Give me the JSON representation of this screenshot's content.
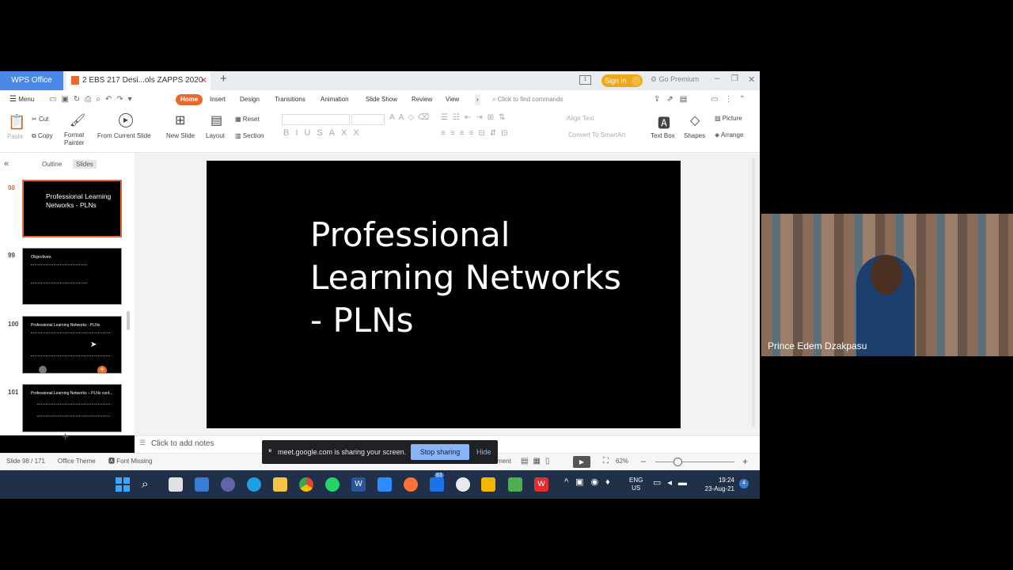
{
  "titlebar": {
    "app_tab": "WPS Office",
    "doc_tab": "2 EBS 217 Desi...ols ZAPPS 2020",
    "sign_in": "Sign in",
    "go_premium": "Go Premium"
  },
  "menu": {
    "menu_label": "Menu",
    "tabs": [
      "Home",
      "Insert",
      "Design",
      "Transitions",
      "Animation",
      "Slide Show",
      "Review",
      "View"
    ],
    "search_placeholder": "Click to find commands"
  },
  "ribbon": {
    "paste": "Paste",
    "cut": "Cut",
    "copy": "Copy",
    "format_painter": "Format\nPainter",
    "from_current_slide": "From Current Slide",
    "new_slide": "New Slide",
    "layout": "Layout",
    "reset": "Reset",
    "section": "Section",
    "align_text": "Align Text",
    "convert_smartart": "Convert To SmartArt",
    "text_box": "Text Box",
    "shapes": "Shapes",
    "picture": "Picture",
    "arrange": "Arrange"
  },
  "left_panel": {
    "outline_tab": "Outline",
    "slides_tab": "Slides",
    "thumbnails": [
      {
        "number": "98",
        "title": "Professional Learning Networks - PLNs",
        "selected": true
      },
      {
        "number": "99",
        "title": "Objectives",
        "selected": false
      },
      {
        "number": "100",
        "title": "Professional Learning Networks - PLNs",
        "selected": false
      },
      {
        "number": "101",
        "title": "Professional Learning Networks – PLNs cont...",
        "selected": false
      }
    ]
  },
  "slide": {
    "title_line1": "Professional",
    "title_line2": "Learning Networks",
    "title_line3": "- PLNs"
  },
  "notes": {
    "placeholder": "Click to add notes"
  },
  "status": {
    "slide_counter": "Slide 98 / 171",
    "theme": "Office Theme",
    "font_missing": "Font Missing",
    "comment_partial": "ment",
    "zoom": "62%"
  },
  "share_banner": {
    "message": "meet.google.com is sharing your screen.",
    "stop_label": "Stop sharing",
    "hide_label": "Hide"
  },
  "taskbar": {
    "badge": "83",
    "lang_line1": "ENG",
    "lang_line2": "US",
    "time": "19:24",
    "date": "23-Aug-21",
    "notifications": "4"
  },
  "video": {
    "participant_name": "Prince Edem Dzakpasu"
  },
  "colors": {
    "accent": "#e8692c",
    "wps_blue": "#4a8ae6",
    "sign_in": "#f0a817",
    "share_button": "#8ab4f8",
    "taskbar": "#1f3048"
  }
}
